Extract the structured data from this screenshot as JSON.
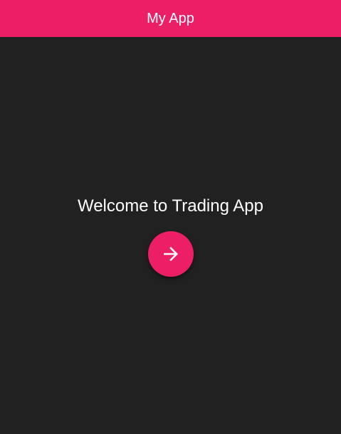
{
  "app_bar": {
    "title": "My App",
    "color": "#ec1f66"
  },
  "main": {
    "welcome_text": "Welcome to Trading App",
    "next_button": {
      "icon": "arrow-right-icon",
      "color": "#ec1f66"
    }
  },
  "theme": {
    "background": "#212121",
    "text_color": "#ffffff"
  }
}
